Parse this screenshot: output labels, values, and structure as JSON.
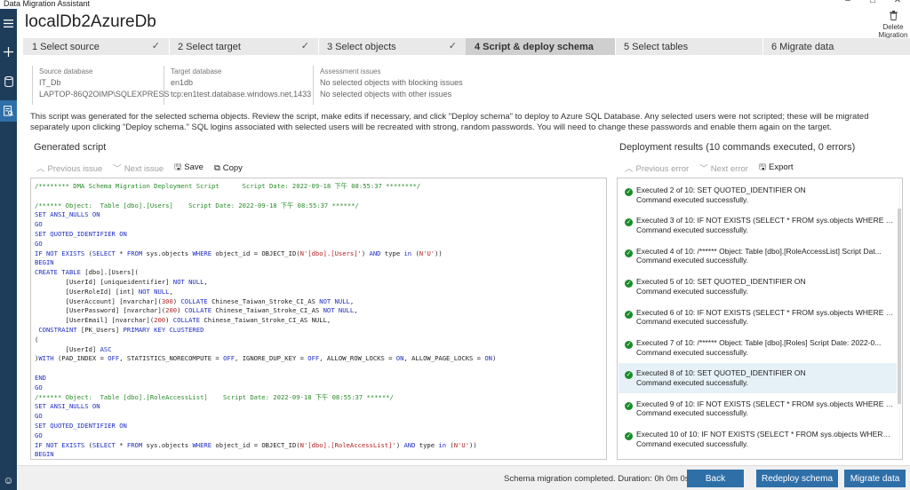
{
  "window": {
    "title": "Data Migration Assistant",
    "controls": [
      "–",
      "□",
      "✕"
    ]
  },
  "rail": {
    "items": [
      "menu-icon",
      "add-icon",
      "database-icon",
      "assessment-icon"
    ],
    "active_index": 3,
    "feedback_icon": "smiley-icon"
  },
  "project": {
    "title": "localDb2AzureDb",
    "delete_label_1": "Delete",
    "delete_label_2": "Migration"
  },
  "steps": [
    {
      "label": "1  Select source",
      "done": true
    },
    {
      "label": "2  Select target",
      "done": true
    },
    {
      "label": "3  Select objects",
      "done": true
    },
    {
      "label": "4  Script & deploy schema",
      "done": false,
      "active": true
    },
    {
      "label": "5  Select tables",
      "done": false
    },
    {
      "label": "6  Migrate data",
      "done": false
    }
  ],
  "source": {
    "label": "Source database",
    "name": "IT_Db",
    "server": "LAPTOP-86Q2OIMP\\SQLEXPRESS"
  },
  "target": {
    "label": "Target database",
    "name": "en1db",
    "server": "tcp:en1test.database.windows.net,1433"
  },
  "assessment": {
    "label": "Assessment issues",
    "blocking": "No selected objects with blocking issues",
    "other": "No selected objects with other issues"
  },
  "description": "This script was generated for the selected schema objects. Review the script, make edits if necessary, and click \"Deploy schema\" to deploy to Azure SQL Database. Any selected users were not scripted; these will be migrated separately upon clicking \"Deploy schema.\" SQL logins associated with selected users will be recreated with strong, random passwords. You will need to change these passwords and enable them again on the target.",
  "script_panel": {
    "title": "Generated script",
    "prev_issue": "Previous issue",
    "next_issue": "Next issue",
    "save": "Save",
    "copy": "Copy"
  },
  "results_panel": {
    "title": "Deployment results (10 commands executed, 0 errors)",
    "prev_error": "Previous error",
    "next_error": "Next error",
    "export": "Export",
    "items": [
      {
        "line1": "Executed 2 of 10: SET QUOTED_IDENTIFIER ON",
        "line2": "Command executed successfully."
      },
      {
        "line1": "Executed 3 of 10: IF NOT EXISTS (SELECT * FROM sys.objects WHERE obje...",
        "line2": "Command executed successfully."
      },
      {
        "line1": "Executed 4 of 10: /****** Object:  Table [dbo].[RoleAccessList]    Script Dat...",
        "line2": "Command executed successfully."
      },
      {
        "line1": "Executed 5 of 10: SET QUOTED_IDENTIFIER ON",
        "line2": "Command executed successfully."
      },
      {
        "line1": "Executed 6 of 10: IF NOT EXISTS (SELECT * FROM sys.objects WHERE obje...",
        "line2": "Command executed successfully."
      },
      {
        "line1": "Executed 7 of 10: /****** Object:  Table [dbo].[Roles]    Script Date: 2022-0...",
        "line2": "Command executed successfully."
      },
      {
        "line1": "Executed 8 of 10: SET QUOTED_IDENTIFIER ON",
        "line2": "Command executed successfully.",
        "highlight": true
      },
      {
        "line1": "Executed 9 of 10: IF NOT EXISTS (SELECT * FROM sys.objects WHERE obje...",
        "line2": "Command executed successfully."
      },
      {
        "line1": "Executed 10 of 10: IF NOT EXISTS (SELECT * FROM sys.objects WHERE obj...",
        "line2": "Command executed successfully."
      }
    ]
  },
  "script_lines": [
    [
      [
        "cm",
        "/******** DMA Schema Migration Deployment Script      Script Date: 2022-09-18 下午 08:55:37 ********/"
      ]
    ],
    [],
    [
      [
        "cm",
        "/****** Object:  Table [dbo].[Users]    Script Date: 2022-09-18 下午 08:55:37 ******/"
      ]
    ],
    [
      [
        "kw",
        "SET ANSI_NULLS ON"
      ]
    ],
    [
      [
        "kw",
        "GO"
      ]
    ],
    [
      [
        "kw",
        "SET QUOTED_IDENTIFIER ON"
      ]
    ],
    [
      [
        "kw",
        "GO"
      ]
    ],
    [
      [
        "kw",
        "IF NOT EXISTS "
      ],
      [
        "",
        "("
      ],
      [
        "kw",
        "SELECT"
      ],
      [
        "",
        " * "
      ],
      [
        "kw",
        "FROM"
      ],
      [
        "",
        " sys.objects "
      ],
      [
        "kw",
        "WHERE"
      ],
      [
        "",
        " object_id = OBJECT_ID("
      ],
      [
        "st",
        "N'[dbo].[Users]'"
      ],
      [
        "",
        ") "
      ],
      [
        "kw",
        "AND"
      ],
      [
        "",
        " type "
      ],
      [
        "kw",
        "in"
      ],
      [
        "",
        " ("
      ],
      [
        "st",
        "N'U'"
      ],
      [
        "",
        "))"
      ]
    ],
    [
      [
        "kw",
        "BEGIN"
      ]
    ],
    [
      [
        "kw",
        "CREATE TABLE "
      ],
      [
        "",
        "[dbo].[Users]("
      ]
    ],
    [
      [
        "",
        "        [UserId] [uniqueidentifier] "
      ],
      [
        "kw",
        "NOT NULL"
      ],
      [
        "",
        ","
      ]
    ],
    [
      [
        "",
        "        [UserRoleId] [int] "
      ],
      [
        "kw",
        "NOT NULL"
      ],
      [
        "",
        ","
      ]
    ],
    [
      [
        "",
        "        [UserAccount] [nvarchar]("
      ],
      [
        "st",
        "300"
      ],
      [
        "",
        ") "
      ],
      [
        "kw",
        "COLLATE"
      ],
      [
        "",
        " Chinese_Taiwan_Stroke_CI_AS "
      ],
      [
        "kw",
        "NOT NULL"
      ],
      [
        "",
        ","
      ]
    ],
    [
      [
        "",
        "        [UserPassword] [nvarchar]("
      ],
      [
        "st",
        "200"
      ],
      [
        "",
        ") "
      ],
      [
        "kw",
        "COLLATE"
      ],
      [
        "",
        " Chinese_Taiwan_Stroke_CI_AS "
      ],
      [
        "kw",
        "NOT NULL"
      ],
      [
        "",
        ","
      ]
    ],
    [
      [
        "",
        "        [UserEmail] [nvarchar]("
      ],
      [
        "st",
        "200"
      ],
      [
        "",
        ") "
      ],
      [
        "kw",
        "COLLATE"
      ],
      [
        "",
        " Chinese_Taiwan_Stroke_CI_AS NULL,"
      ]
    ],
    [
      [
        "kw",
        " CONSTRAINT"
      ],
      [
        "",
        " [PK_Users] "
      ],
      [
        "kw",
        "PRIMARY KEY CLUSTERED"
      ]
    ],
    [
      [
        "",
        "("
      ]
    ],
    [
      [
        "",
        "        [UserId] "
      ],
      [
        "kw",
        "ASC"
      ]
    ],
    [
      [
        "",
        ")"
      ],
      [
        "kw",
        "WITH"
      ],
      [
        "",
        " (PAD_INDEX = "
      ],
      [
        "kw",
        "OFF"
      ],
      [
        "",
        ", STATISTICS_NORECOMPUTE = "
      ],
      [
        "kw",
        "OFF"
      ],
      [
        "",
        ", IGNORE_DUP_KEY = "
      ],
      [
        "kw",
        "OFF"
      ],
      [
        "",
        ", ALLOW_ROW_LOCKS = "
      ],
      [
        "kw",
        "ON"
      ],
      [
        "",
        ", ALLOW_PAGE_LOCKS = "
      ],
      [
        "kw",
        "ON"
      ],
      [
        "",
        ")"
      ]
    ],
    [],
    [
      [
        "kw",
        "END"
      ]
    ],
    [
      [
        "kw",
        "GO"
      ]
    ],
    [
      [
        "cm",
        "/****** Object:  Table [dbo].[RoleAccessList]    Script Date: 2022-09-18 下午 08:55:37 ******/"
      ]
    ],
    [
      [
        "kw",
        "SET ANSI_NULLS ON"
      ]
    ],
    [
      [
        "kw",
        "GO"
      ]
    ],
    [
      [
        "kw",
        "SET QUOTED_IDENTIFIER ON"
      ]
    ],
    [
      [
        "kw",
        "GO"
      ]
    ],
    [
      [
        "kw",
        "IF NOT EXISTS "
      ],
      [
        "",
        "("
      ],
      [
        "kw",
        "SELECT"
      ],
      [
        "",
        " * "
      ],
      [
        "kw",
        "FROM"
      ],
      [
        "",
        " sys.objects "
      ],
      [
        "kw",
        "WHERE"
      ],
      [
        "",
        " object_id = OBJECT_ID("
      ],
      [
        "st",
        "N'[dbo].[RoleAccessList]'"
      ],
      [
        "",
        ") "
      ],
      [
        "kw",
        "AND"
      ],
      [
        "",
        " type "
      ],
      [
        "kw",
        "in"
      ],
      [
        "",
        " ("
      ],
      [
        "st",
        "N'U'"
      ],
      [
        "",
        "))"
      ]
    ],
    [
      [
        "kw",
        "BEGIN"
      ]
    ]
  ],
  "footer": {
    "status": "Schema migration completed.  Duration: 0h 0m 0s",
    "back": "Back",
    "redeploy": "Redeploy schema",
    "migrate": "Migrate data"
  },
  "colors": {
    "rail": "#1e3d5a",
    "accent": "#2f6fa8",
    "success": "#1a8c2a",
    "comment": "#2a8c2a",
    "keyword": "#1f2fbf",
    "string": "#b22222"
  }
}
